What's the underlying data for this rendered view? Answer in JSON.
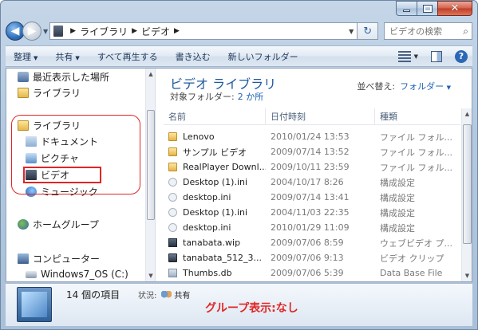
{
  "window": {
    "breadcrumb": [
      "ライブラリ",
      "ビデオ"
    ],
    "search_placeholder": "ビデオの検索"
  },
  "icons": {
    "back": "back-arrow-icon",
    "forward": "forward-arrow-icon",
    "refresh": "refresh-icon",
    "search": "search-icon",
    "help": "help-icon"
  },
  "toolbar": {
    "organize": "整理",
    "share": "共有",
    "play_all": "すべて再生する",
    "burn": "書き込む",
    "new_folder": "新しいフォルダー"
  },
  "sidebar": {
    "recent": "最近表示した場所",
    "libraries_top": "ライブラリ",
    "libraries": "ライブラリ",
    "documents": "ドキュメント",
    "pictures": "ピクチャ",
    "videos": "ビデオ",
    "music": "ミュージック",
    "homegroup": "ホームグループ",
    "computer": "コンピューター",
    "drive": "Windows7_OS (C:)"
  },
  "library": {
    "title": "ビデオ ライブラリ",
    "target_label": "対象フォルダー:",
    "target_value": "2 か所",
    "arrange_label": "並べ替え:",
    "arrange_value": "フォルダー"
  },
  "columns": {
    "name": "名前",
    "date": "日付時刻",
    "type": "種類"
  },
  "files": [
    {
      "name": "Lenovo",
      "date": "2010/01/24 13:53",
      "type": "ファイル フォル...",
      "icon": "folder-icon"
    },
    {
      "name": "サンプル ビデオ",
      "date": "2009/07/14 13:52",
      "type": "ファイル フォル...",
      "icon": "folder-icon"
    },
    {
      "name": "RealPlayer Downl...",
      "date": "2009/10/11 23:59",
      "type": "ファイル フォル...",
      "icon": "folder-icon"
    },
    {
      "name": "Desktop (1).ini",
      "date": "2004/10/17 8:26",
      "type": "構成設定",
      "icon": "settings-file-icon"
    },
    {
      "name": "desktop.ini",
      "date": "2009/07/14 13:41",
      "type": "構成設定",
      "icon": "settings-file-icon"
    },
    {
      "name": "Desktop (1).ini",
      "date": "2004/11/03 22:35",
      "type": "構成設定",
      "icon": "settings-file-icon"
    },
    {
      "name": "desktop.ini",
      "date": "2010/01/29 11:09",
      "type": "構成設定",
      "icon": "settings-file-icon"
    },
    {
      "name": "tanabata.wip",
      "date": "2009/07/06 8:59",
      "type": "ウェブビデオ プ...",
      "icon": "video-project-icon"
    },
    {
      "name": "tanabata_512_3...",
      "date": "2009/07/06 9:13",
      "type": "ビデオ クリップ",
      "icon": "video-clip-icon"
    },
    {
      "name": "Thumbs.db",
      "date": "2009/07/06 5:39",
      "type": "Data Base File",
      "icon": "database-file-icon"
    }
  ],
  "details": {
    "count": "14 個の項目",
    "status_label": "状況:",
    "status_value": "共有",
    "annotation": "グループ表示:なし"
  }
}
